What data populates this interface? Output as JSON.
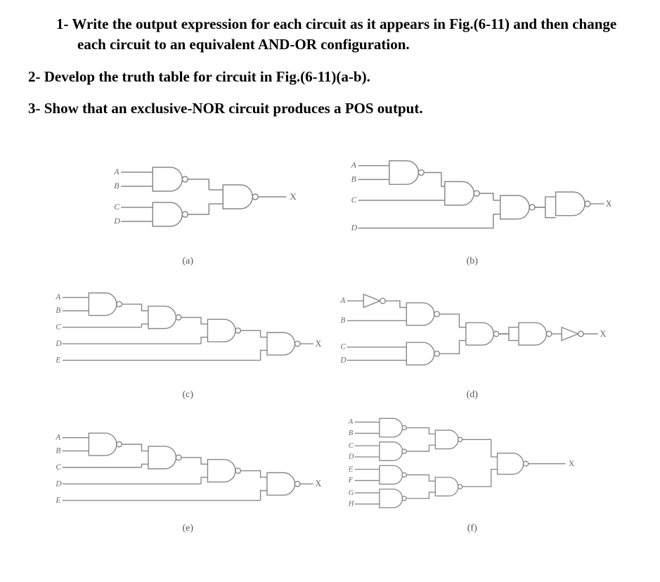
{
  "questions": {
    "q1": "1- Write the output expression for each circuit as it appears in Fig.(6-11) and then change each circuit to an equivalent AND-OR configuration.",
    "q2": "2- Develop the truth table for  circuit in Fig.(6-11)(a-b).",
    "q3": "3- Show that an exclusive-NOR circuit produces a POS output."
  },
  "circuits": {
    "a": {
      "caption": "(a)",
      "inputs": [
        "A",
        "B",
        "C",
        "D"
      ],
      "output": "X",
      "gates": [
        {
          "type": "NAND",
          "inputs": [
            "A",
            "B"
          ]
        },
        {
          "type": "NAND",
          "inputs": [
            "C",
            "D"
          ]
        },
        {
          "type": "NAND",
          "inputs": [
            "g0",
            "g1"
          ],
          "out": "X"
        }
      ]
    },
    "b": {
      "caption": "(b)",
      "inputs": [
        "A",
        "B",
        "C",
        "D"
      ],
      "output": "X",
      "gates": [
        {
          "type": "NAND",
          "inputs": [
            "A",
            "B"
          ]
        },
        {
          "type": "NAND",
          "inputs": [
            "g0",
            "C"
          ]
        },
        {
          "type": "NAND",
          "inputs": [
            "g1",
            "D"
          ]
        },
        {
          "type": "NAND",
          "inputs": [
            "g2_branch1",
            "g2_branch2"
          ],
          "out": "X"
        }
      ]
    },
    "c": {
      "caption": "(c)",
      "inputs": [
        "A",
        "B",
        "C",
        "D",
        "E"
      ],
      "output": "X",
      "gates": [
        {
          "type": "NAND",
          "inputs": [
            "A",
            "B"
          ]
        },
        {
          "type": "NAND",
          "inputs": [
            "g0",
            "C"
          ]
        },
        {
          "type": "NAND",
          "inputs": [
            "g1",
            "D"
          ]
        },
        {
          "type": "NAND",
          "inputs": [
            "g2",
            "E"
          ],
          "out": "X"
        }
      ]
    },
    "d": {
      "caption": "(d)",
      "inputs": [
        "A",
        "B",
        "C",
        "D"
      ],
      "output": "X",
      "gates": [
        {
          "type": "NOT",
          "inputs": [
            "A"
          ]
        },
        {
          "type": "NAND",
          "inputs": [
            "g0",
            "B"
          ]
        },
        {
          "type": "NAND",
          "inputs": [
            "C",
            "D"
          ]
        },
        {
          "type": "NAND",
          "inputs": [
            "g1",
            "g2"
          ]
        },
        {
          "type": "NAND",
          "inputs": [
            "g3",
            "g3"
          ]
        },
        {
          "type": "NOT",
          "inputs": [
            "g4"
          ],
          "out": "X"
        }
      ]
    },
    "e": {
      "caption": "(e)",
      "inputs": [
        "A",
        "B",
        "C",
        "D",
        "E"
      ],
      "output": "X",
      "gates": [
        {
          "type": "NAND",
          "inputs": [
            "A",
            "B"
          ]
        },
        {
          "type": "NAND",
          "inputs": [
            "g0",
            "C"
          ]
        },
        {
          "type": "NAND",
          "inputs": [
            "g1",
            "D"
          ]
        },
        {
          "type": "NAND",
          "inputs": [
            "g2",
            "E"
          ],
          "out": "X"
        }
      ]
    },
    "f": {
      "caption": "(f)",
      "inputs": [
        "A",
        "B",
        "C",
        "D",
        "E",
        "F",
        "G",
        "H"
      ],
      "output": "X",
      "gates": [
        {
          "type": "NAND",
          "inputs": [
            "A",
            "B"
          ]
        },
        {
          "type": "NAND",
          "inputs": [
            "C",
            "D"
          ]
        },
        {
          "type": "NAND",
          "inputs": [
            "E",
            "F"
          ]
        },
        {
          "type": "NAND",
          "inputs": [
            "G",
            "H"
          ]
        },
        {
          "type": "NAND",
          "inputs": [
            "g0",
            "g1"
          ]
        },
        {
          "type": "NAND",
          "inputs": [
            "g2",
            "g3"
          ]
        },
        {
          "type": "NAND",
          "inputs": [
            "g4",
            "g5"
          ],
          "out": "X"
        }
      ]
    }
  }
}
